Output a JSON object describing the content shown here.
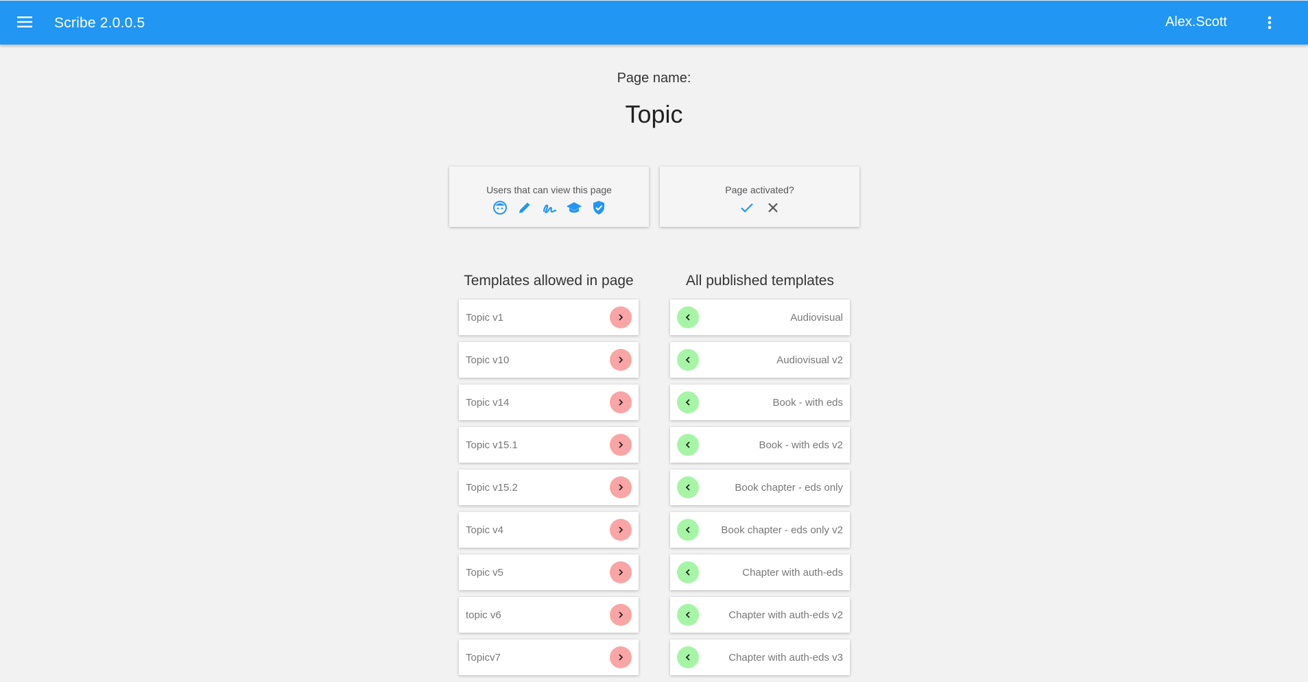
{
  "app": {
    "title": "Scribe 2.0.0.5",
    "user": "Alex.Scott"
  },
  "icons": {
    "menu": "menu-icon",
    "more": "more-vert-icon"
  },
  "colors": {
    "primary": "#2196f3",
    "remove": "#f9a5a5",
    "add": "#a6f5a6"
  },
  "page": {
    "label": "Page name:",
    "name": "Topic"
  },
  "viewers_card": {
    "label": "Users that can view this page",
    "icons": [
      "face-icon",
      "pencil-icon",
      "signature-icon",
      "school-icon",
      "shield-check-icon"
    ]
  },
  "activated_card": {
    "label": "Page activated?",
    "icons": [
      "check-icon",
      "close-icon"
    ]
  },
  "allowed": {
    "title": "Templates allowed in page",
    "items": [
      "Topic v1",
      "Topic v10",
      "Topic v14",
      "Topic v15.1",
      "Topic v15.2",
      "Topic v4",
      "Topic v5",
      "topic v6",
      "Topicv7"
    ]
  },
  "published": {
    "title": "All published templates",
    "items": [
      "Audiovisual",
      "Audiovisual v2",
      "Book - with eds",
      "Book - with eds v2",
      "Book chapter - eds only",
      "Book chapter - eds only v2",
      "Chapter with auth-eds",
      "Chapter with auth-eds v2",
      "Chapter with auth-eds v3"
    ]
  }
}
